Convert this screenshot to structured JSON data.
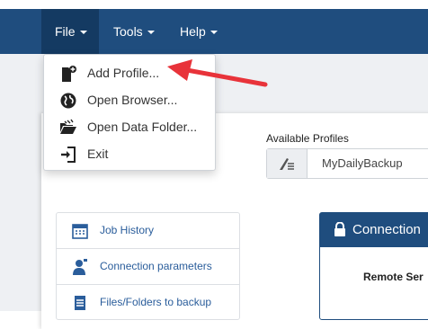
{
  "navbar": {
    "file": "File",
    "tools": "Tools",
    "help": "Help",
    "bg_color": "#1f4d7e"
  },
  "file_menu": {
    "items": [
      {
        "label": "Add Profile...",
        "icon": "add-profile-icon"
      },
      {
        "label": "Open Browser...",
        "icon": "globe-icon"
      },
      {
        "label": "Open Data Folder...",
        "icon": "folder-open-icon"
      },
      {
        "label": "Exit",
        "icon": "exit-icon"
      }
    ]
  },
  "profiles": {
    "label": "Available Profiles",
    "selected": "MyDailyBackup"
  },
  "side_menu": {
    "items": [
      {
        "label": "Job History",
        "icon": "calendar-icon"
      },
      {
        "label": "Connection parameters",
        "icon": "user-tie-icon"
      },
      {
        "label": "Files/Folders to backup",
        "icon": "document-list-icon"
      }
    ]
  },
  "connection_panel": {
    "title": "Connection",
    "remote_label": "Remote Ser"
  },
  "annotation": {
    "arrow_color": "#e8333a"
  }
}
